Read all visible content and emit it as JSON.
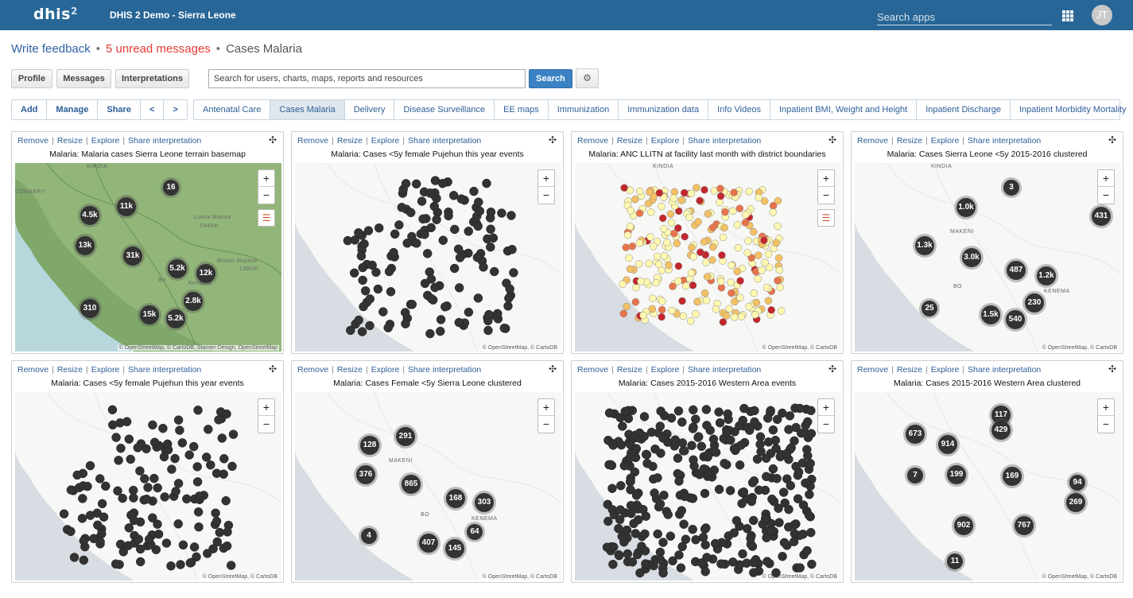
{
  "header": {
    "logo": "dhis",
    "logo_sup": "2",
    "title": "DHIS 2 Demo - Sierra Leone",
    "search_placeholder": "Search apps",
    "avatar": "JT"
  },
  "feedback": {
    "write": "Write feedback",
    "unread": "5 unread messages",
    "current": "Cases Malaria"
  },
  "toolbar": {
    "profile": "Profile",
    "messages": "Messages",
    "interpretations": "Interpretations",
    "search_placeholder": "Search for users, charts, maps, reports and resources",
    "search": "Search",
    "settings_icon": "gear-icon"
  },
  "actions": [
    "Add",
    "Manage",
    "Share",
    "<",
    ">"
  ],
  "tabs": [
    "Antenatal Care",
    "Cases Malaria",
    "Delivery",
    "Disease Surveillance",
    "EE maps",
    "Immunization",
    "Immunization data",
    "Info Videos",
    "Inpatient BMI, Weight and Height",
    "Inpatient Discharge",
    "Inpatient Morbidity Mortality"
  ],
  "active_tab": "Cases Malaria",
  "card_links": {
    "remove": "Remove",
    "resize": "Resize",
    "explore": "Explore",
    "share": "Share interpretation"
  },
  "zoom": {
    "in": "+",
    "out": "−"
  },
  "cards": [
    {
      "title": "Malaria: Malaria cases Sierra Leone terrain basemap",
      "attribution": "© OpenStreetMap, © CartoDB, Stamen Design, OpenStreetMap",
      "legend": true,
      "labels": [
        "KINDIA",
        "CONAKRY",
        "Loma Mansa",
        "1945m",
        "Bo",
        "Kenema",
        "Mount Wuteve",
        "1380m"
      ],
      "clusters": [
        "16",
        "11k",
        "4.5k",
        "13k",
        "31k",
        "5.2k",
        "12k",
        "2.8k",
        "310",
        "15k",
        "5.2k"
      ]
    },
    {
      "title": "Malaria: Cases <5y female Pujehun this year events",
      "attribution": "© OpenStreetMap, © CartoDB",
      "legend": false,
      "labels": [],
      "clusters": []
    },
    {
      "title": "Malaria: ANC LLITN at facility last month with district boundaries",
      "attribution": "© OpenStreetMap, © CartoDB",
      "legend": true,
      "labels": [
        "KINDIA"
      ],
      "clusters": []
    },
    {
      "title": "Malaria: Cases Sierra Leone <5y 2015-2016 clustered",
      "attribution": "© OpenStreetMap, © CartoDB",
      "legend": false,
      "labels": [
        "KINDIA",
        "MAKENI",
        "BO",
        "KENEMA"
      ],
      "clusters": [
        "3",
        "431",
        "1.0k",
        "1.3k",
        "3.0k",
        "487",
        "1.2k",
        "230",
        "25",
        "1.5k",
        "540"
      ]
    },
    {
      "title": "Malaria: Cases <5y female Pujehun this year events",
      "attribution": "© OpenStreetMap, © CartoDB",
      "legend": false,
      "labels": [],
      "clusters": []
    },
    {
      "title": "Malaria: Cases Female <5y Sierra Leone clustered",
      "attribution": "© OpenStreetMap, © CartoDB",
      "legend": false,
      "labels": [
        "MAKENI",
        "BO",
        "KENEMA"
      ],
      "clusters": [
        "128",
        "291",
        "376",
        "865",
        "168",
        "303",
        "64",
        "4",
        "407",
        "145"
      ]
    },
    {
      "title": "Malaria: Cases 2015-2016 Western Area events",
      "attribution": "© OpenStreetMap, © CartoDB",
      "legend": false,
      "labels": [],
      "clusters": []
    },
    {
      "title": "Malaria: Cases 2015-2016 Western Area clustered",
      "attribution": "© OpenStreetMap, © CartoDB",
      "legend": false,
      "labels": [],
      "clusters": [
        "117",
        "429",
        "673",
        "914",
        "7",
        "199",
        "169",
        "94",
        "269",
        "902",
        "767",
        "11"
      ]
    }
  ]
}
